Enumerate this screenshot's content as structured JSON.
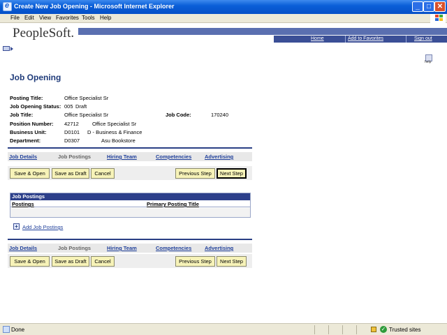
{
  "window": {
    "title": "Create New Job Opening - Microsoft Internet Explorer",
    "minimize": "_",
    "maximize": "□",
    "close": "✕"
  },
  "menubar": {
    "items": [
      "File",
      "Edit",
      "View",
      "Favorites",
      "Tools",
      "Help"
    ]
  },
  "header": {
    "logo": "PeopleSoft.",
    "nav": {
      "home": "Home",
      "add_to_favorites": "Add to Favorites",
      "sign_out": "Sign out"
    },
    "help_label": "help"
  },
  "page": {
    "title": "Job Opening"
  },
  "fields": {
    "posting_title_label": "Posting Title:",
    "posting_title": "Office Specialist Sr",
    "status_label": "Job Opening Status:",
    "status_code": "005",
    "status_text": "Draft",
    "job_title_label": "Job Title:",
    "job_title": "Office Specialist Sr",
    "job_code_label": "Job Code:",
    "job_code": "170240",
    "position_number_label": "Position Number:",
    "position_number": "42712",
    "position_desc": "Office Specialist Sr",
    "business_unit_label": "Business Unit:",
    "business_unit": "D0101",
    "business_unit_desc": "D - Business & Finance",
    "department_label": "Department:",
    "department": "D0307",
    "department_desc": "Asu Bookstore"
  },
  "tabs": {
    "job_details": "Job Details",
    "job_postings": "Job Postings",
    "hiring_team": "Hiring Team",
    "competencies": "Competencies",
    "advertising": "Advertising"
  },
  "buttons": {
    "save_open": "Save & Open",
    "save_draft": "Save as Draft",
    "cancel": "Cancel",
    "previous_step": "Previous Step",
    "next_step": "Next Step"
  },
  "postings_grid": {
    "title": "Job Postings",
    "col_postings": "Postings",
    "col_primary_title": "Primary Posting Title"
  },
  "add_link": "Add Job Postings",
  "status": {
    "text": "Done",
    "zone": "Trusted sites"
  }
}
